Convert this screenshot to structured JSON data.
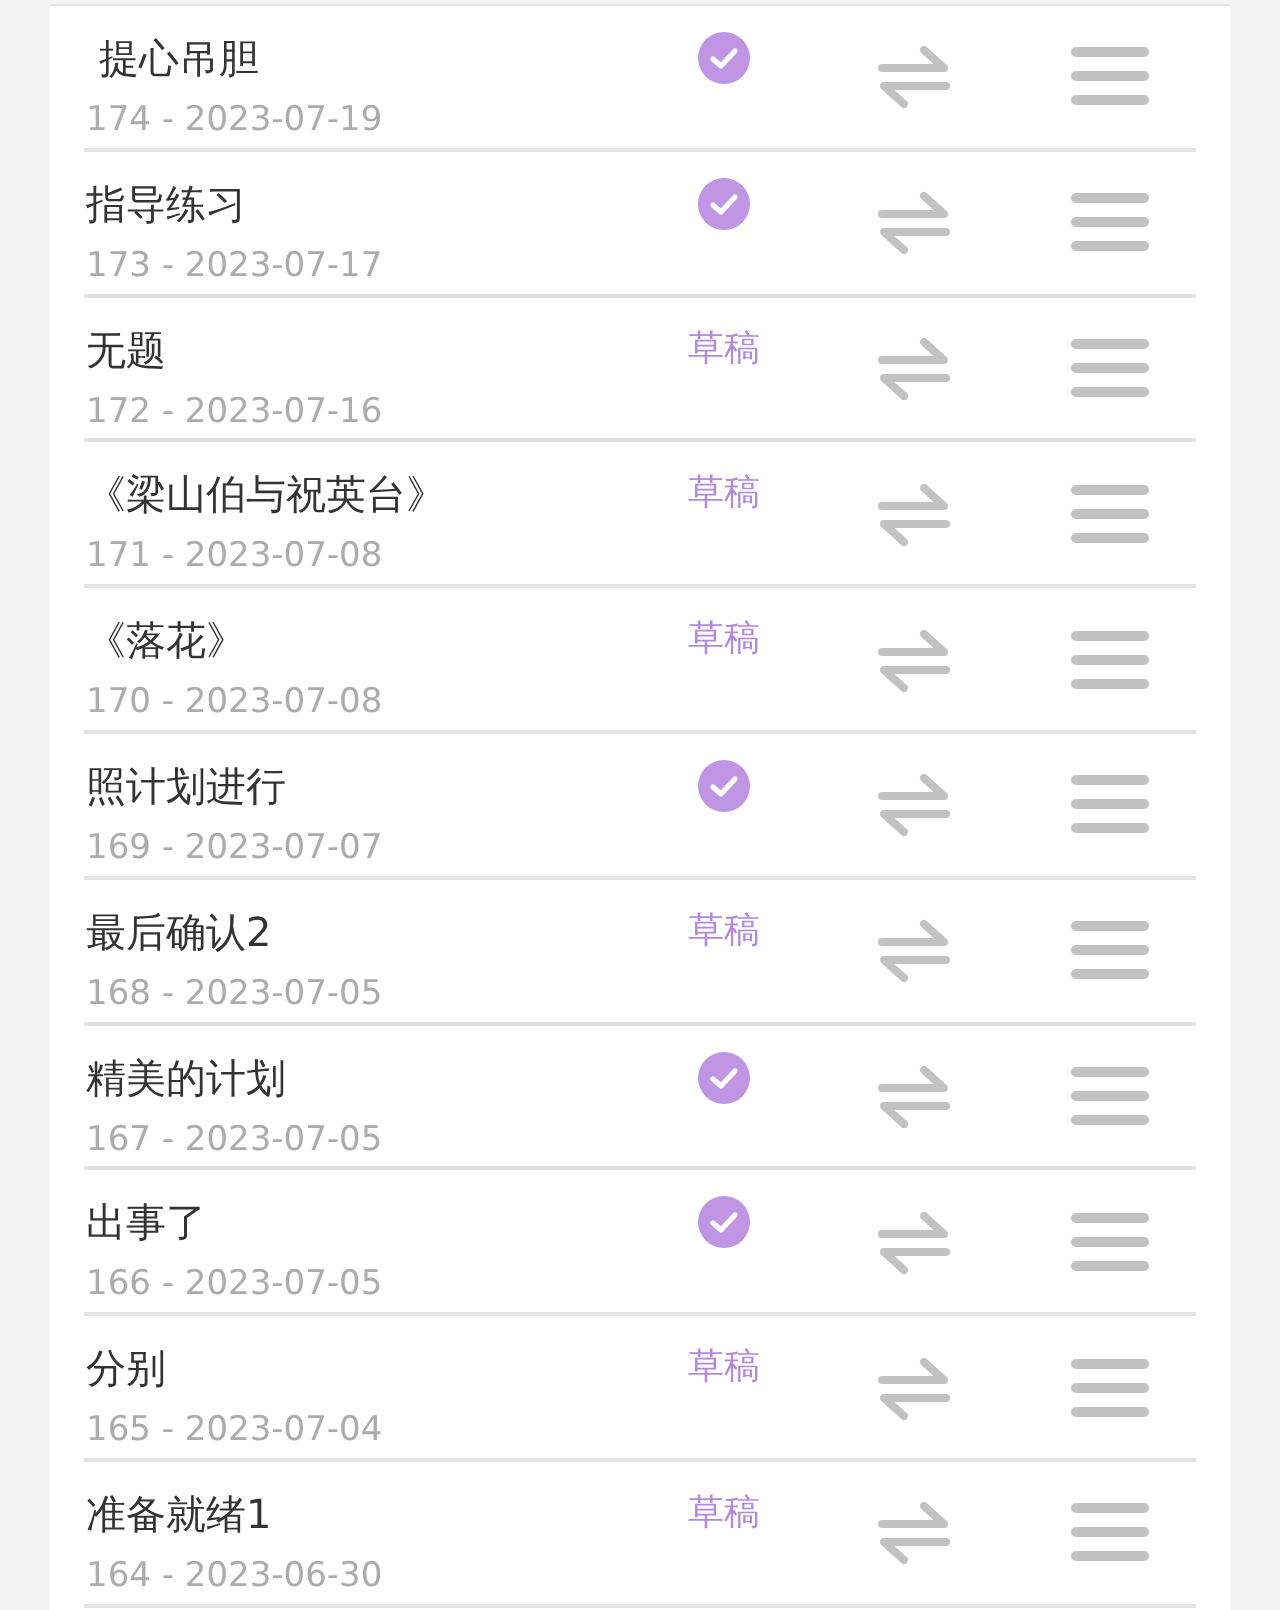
{
  "items": [
    {
      "title": " 提心吊胆",
      "meta": "174 - 2023-07-19",
      "kind": "published"
    },
    {
      "title": "指导练习",
      "meta": "173 - 2023-07-17",
      "kind": "published"
    },
    {
      "title": "无题",
      "meta": "172 - 2023-07-16",
      "kind": "draft",
      "status_label": "草稿"
    },
    {
      "title": "《梁山伯与祝英台》",
      "meta": "171 - 2023-07-08",
      "kind": "draft",
      "status_label": "草稿"
    },
    {
      "title": "《落花》",
      "meta": "170 - 2023-07-08",
      "kind": "draft",
      "status_label": "草稿"
    },
    {
      "title": "照计划进行",
      "meta": "169 - 2023-07-07",
      "kind": "published"
    },
    {
      "title": "最后确认2",
      "meta": "168 - 2023-07-05",
      "kind": "draft",
      "status_label": "草稿"
    },
    {
      "title": "精美的计划",
      "meta": "167 - 2023-07-05",
      "kind": "published"
    },
    {
      "title": "出事了",
      "meta": "166 - 2023-07-05",
      "kind": "published"
    },
    {
      "title": "分别",
      "meta": "165 - 2023-07-04",
      "kind": "draft",
      "status_label": "草稿"
    },
    {
      "title": "准备就绪1",
      "meta": "164 - 2023-06-30",
      "kind": "draft",
      "status_label": "草稿"
    }
  ]
}
